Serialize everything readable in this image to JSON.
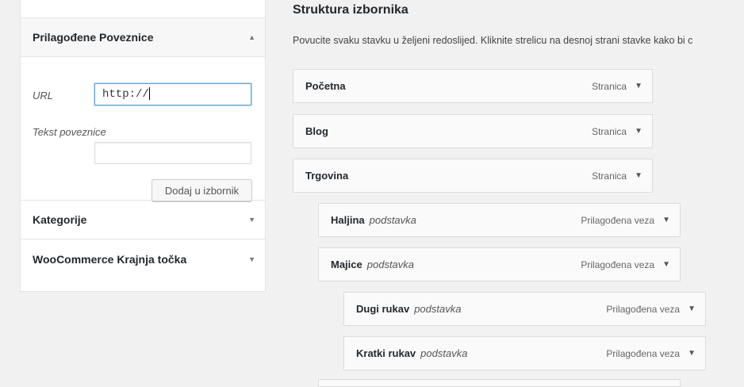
{
  "left_panel": {
    "custom_links": {
      "title": "Prilagođene Poveznice",
      "url_label": "URL",
      "url_value": "http://",
      "text_label": "Tekst poveznice",
      "text_value": "",
      "add_button": "Dodaj u izbornik"
    },
    "categories": {
      "title": "Kategorije"
    },
    "woocommerce": {
      "title": "WooCommerce Krajnja točka"
    }
  },
  "menu_structure": {
    "title": "Struktura izbornika",
    "description": "Povucite svaku stavku u željeni redoslijed. Kliknite strelicu na desnoj strani stavke kako bi c",
    "items": [
      {
        "title": "Početna",
        "sub": "",
        "type": "Stranica"
      },
      {
        "title": "Blog",
        "sub": "",
        "type": "Stranica"
      },
      {
        "title": "Trgovina",
        "sub": "",
        "type": "Stranica"
      },
      {
        "title": "Haljina",
        "sub": "podstavka",
        "type": "Prilagođena veza"
      },
      {
        "title": "Majice",
        "sub": "podstavka",
        "type": "Prilagođena veza"
      },
      {
        "title": "Dugi rukav",
        "sub": "podstavka",
        "type": "Prilagođena veza"
      },
      {
        "title": "Kratki rukav",
        "sub": "podstavka",
        "type": "Prilagođena veza"
      }
    ]
  },
  "icons": {
    "expand": "triangle-down-icon",
    "collapse": "triangle-up-icon"
  }
}
